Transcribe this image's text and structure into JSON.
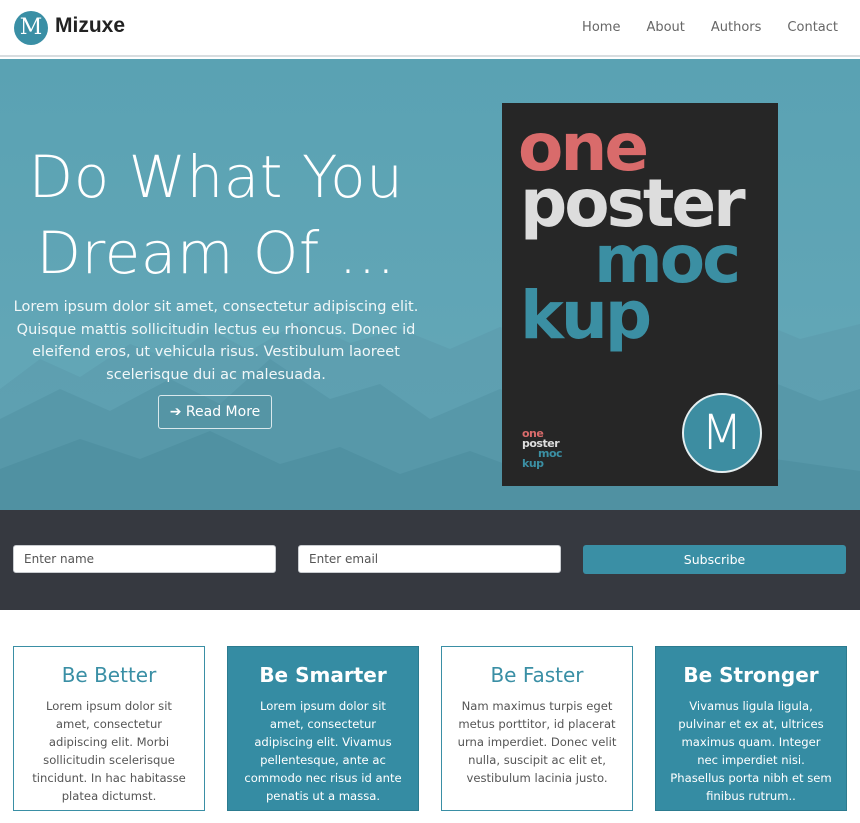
{
  "brand": {
    "logo_letter": "M",
    "name": "Mizuxe"
  },
  "nav": {
    "items": [
      "Home",
      "About",
      "Authors",
      "Contact"
    ]
  },
  "hero": {
    "title_line1": "Do What You",
    "title_line2": "Dream Of ...",
    "text": "Lorem ipsum dolor sit amet, consectetur adipiscing elit. Quisque mattis sollicitudin lectus eu rhoncus. Donec id eleifend eros, ut vehicula risus. Vestibulum laoreet scelerisque dui ac malesuada.",
    "button_label": "Read More",
    "button_icon": "arrow-right-icon"
  },
  "poster": {
    "line1": "one",
    "line2": "poster",
    "line3": "moc",
    "line4": "kup",
    "small_line1": "one",
    "small_line2": "poster",
    "small_line3": "moc",
    "small_line4": "kup",
    "badge_letter": "M",
    "colors": {
      "one": "#d96b6b",
      "poster": "#dddddd",
      "mockup": "#3b8fa3"
    }
  },
  "subscribe": {
    "name_placeholder": "Enter name",
    "email_placeholder": "Enter email",
    "button_label": "Subscribe"
  },
  "features": [
    {
      "title": "Be Better",
      "text": "Lorem ipsum dolor sit amet, consectetur adipiscing elit. Morbi sollicitudin scelerisque tincidunt. In hac habitasse platea dictumst."
    },
    {
      "title": "Be Smarter",
      "text": "Lorem ipsum dolor sit amet, consectetur adipiscing elit. Vivamus pellentesque, ante ac commodo nec risus id ante penatis ut a massa."
    },
    {
      "title": "Be Faster",
      "text": "Nam maximus turpis eget metus porttitor, id placerat urna imperdiet. Donec velit nulla, suscipit ac elit et, vestibulum lacinia justo."
    },
    {
      "title": "Be Stronger",
      "text": "Vivamus ligula ligula, pulvinar et ex at, ultrices maximus quam. Integer nec imperdiet nisi. Phasellus porta nibh et sem finibus rutrum.."
    }
  ],
  "colors": {
    "accent": "#3a8fa5",
    "band": "#363940",
    "hero_bg": "#5fa5b5"
  }
}
